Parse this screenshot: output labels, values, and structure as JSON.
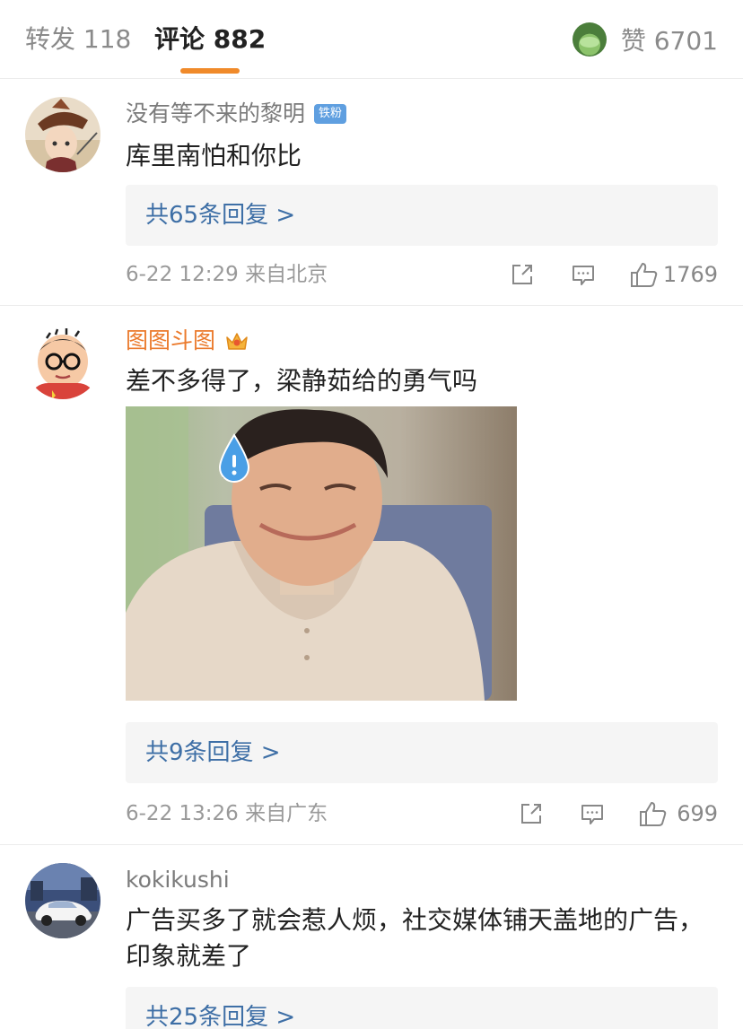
{
  "tabs": {
    "repost": "转发 118",
    "comment": "评论 882",
    "likes": "赞 6701"
  },
  "comments": [
    {
      "user": "没有等不来的黎明",
      "badge": "铁粉",
      "text": "库里南怕和你比",
      "replies": "共65条回复 >",
      "meta": "6-22 12:29 来自北京",
      "likes": "1769"
    },
    {
      "user": "图图斗图",
      "text": "差不多得了，梁静茹给的勇气吗",
      "replies": "共9条回复 >",
      "meta": "6-22 13:26 来自广东",
      "likes": "699"
    },
    {
      "user": "kokikushi",
      "text": "广告买多了就会惹人烦，社交媒体铺天盖地的广告，印象就差了",
      "replies": "共25条回复 >"
    }
  ],
  "colors": {
    "accent_underline": "#f08a2a",
    "link_blue": "#3e6fa6",
    "username_orange": "#eb7a2c",
    "fan_badge": "#5f9fe0"
  },
  "icons": [
    "share-icon",
    "comment-icon",
    "thumbs-up-icon",
    "crown-icon",
    "sweat-drop-icon"
  ]
}
